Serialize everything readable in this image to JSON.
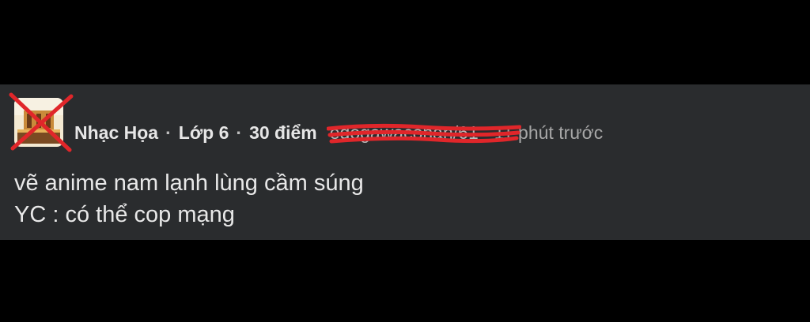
{
  "post": {
    "author": "Nhạc Họa",
    "grade": "Lớp 6",
    "points": "30 điểm",
    "redacted_user": "edogawaconan/61",
    "time_ago": "- 11 phút trước",
    "separator": "·",
    "lines": [
      "vẽ anime nam lạnh lùng cầm súng",
      "YC : có thể cop mạng"
    ]
  },
  "colors": {
    "background": "#000000",
    "post_bg": "#2a2c2e",
    "scribble": "#e0262a"
  }
}
